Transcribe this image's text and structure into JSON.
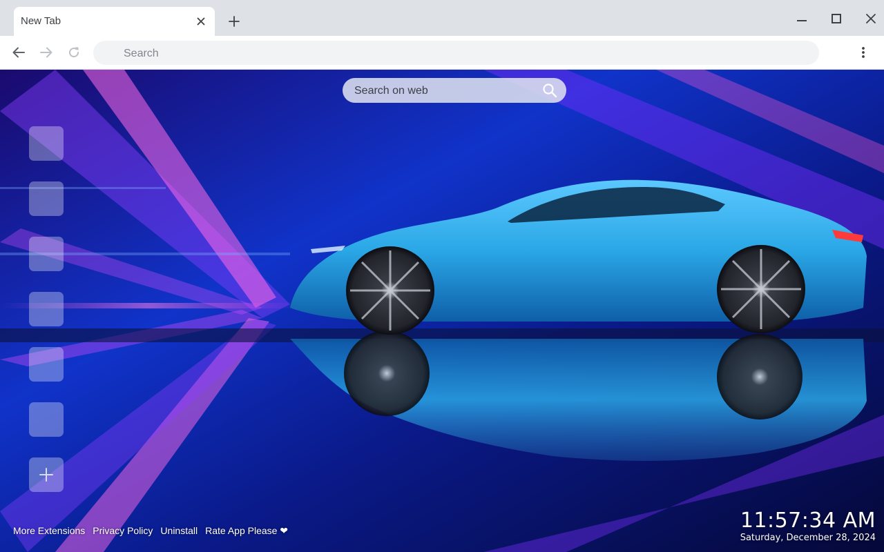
{
  "browser": {
    "tab": {
      "title": "New Tab"
    },
    "omnibox": {
      "placeholder": "Search",
      "value": ""
    }
  },
  "page": {
    "web_search": {
      "placeholder": "Search on web"
    },
    "shortcuts_count_label": "",
    "footer": {
      "links": [
        "More Extensions",
        "Privacy Policy",
        "Uninstall",
        "Rate App Please ❤"
      ]
    },
    "clock": {
      "time": "11:57:34 AM",
      "date": "Saturday, December 28, 2024"
    },
    "wallpaper": {
      "subject": "blue sports car with reflection on neon-lit background"
    }
  },
  "colors": {
    "tabstrip": "#dee1e6",
    "toolbar": "#ffffff",
    "omnibox": "#f1f3f4",
    "accent_car_blue": "#2aa7e6"
  },
  "icons": {
    "tab_close": "close-icon",
    "new_tab": "plus-icon",
    "minimize": "minimize-icon",
    "maximize": "maximize-icon",
    "close_window": "close-icon",
    "back": "arrow-back-icon",
    "forward": "arrow-forward-icon",
    "reload": "reload-icon",
    "menu": "kebab-menu-icon",
    "search": "search-icon",
    "add_shortcut": "plus-icon"
  }
}
